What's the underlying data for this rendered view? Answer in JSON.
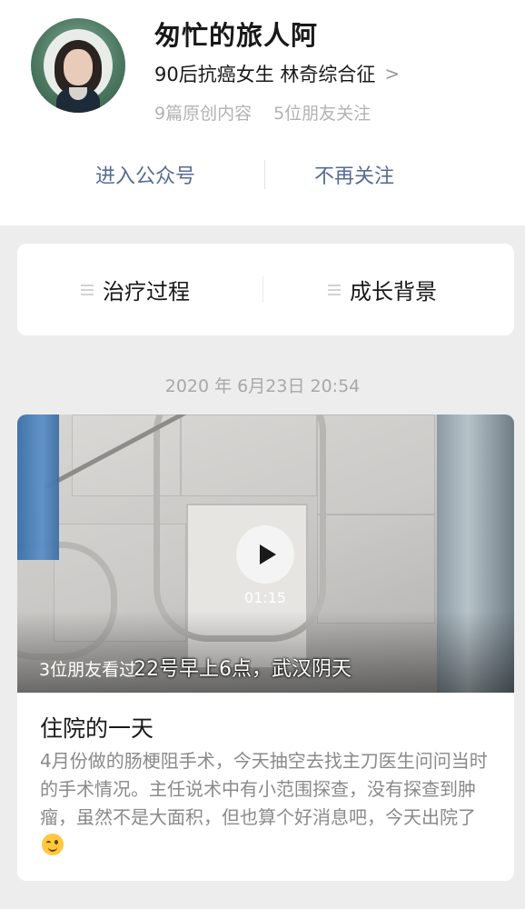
{
  "profile": {
    "name": "匆忙的旅人阿",
    "bio": "90后抗癌女生 林奇综合征",
    "chevron": ">",
    "original_count": "9篇原创内容",
    "friends_follow": "5位朋友关注"
  },
  "actions": {
    "enter": "进入公众号",
    "unfollow": "不再关注"
  },
  "menu": [
    {
      "label": "治疗过程"
    },
    {
      "label": "成长背景"
    }
  ],
  "timestamp": "2020 年 6月23日 20:54",
  "article": {
    "video_duration": "01:15",
    "friends_read": "3位朋友看过",
    "video_caption": "22号早上6点，武汉阴天",
    "title": "住院的一天",
    "summary": "4月份做的肠梗阻手术，今天抽空去找主刀医生问问当时的手术情况。主任说术中有小范围探查，没有探查到肿瘤，虽然不是大面积，但也算个好消息吧，今天出院了"
  }
}
